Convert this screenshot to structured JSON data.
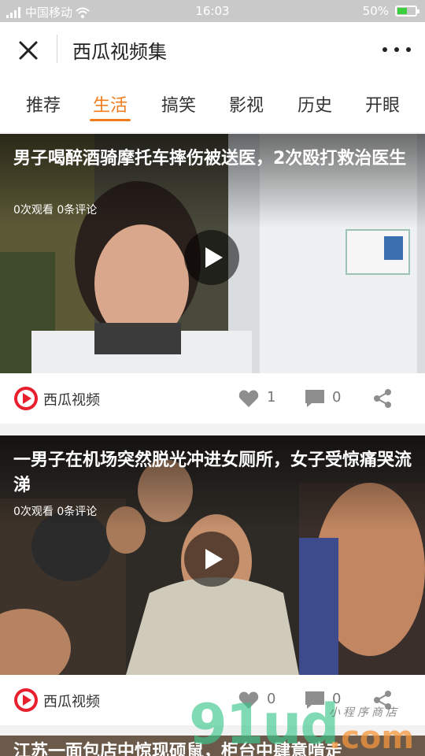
{
  "status_bar": {
    "carrier": "中国移动",
    "time": "16:03",
    "battery": "50%",
    "battery_level": 0.5
  },
  "title_bar": {
    "title": "西瓜视频集"
  },
  "tabs": [
    {
      "label": "推荐",
      "active": false
    },
    {
      "label": "生活",
      "active": true
    },
    {
      "label": "搞笑",
      "active": false
    },
    {
      "label": "影视",
      "active": false
    },
    {
      "label": "历史",
      "active": false
    },
    {
      "label": "开眼",
      "active": false
    }
  ],
  "videos": [
    {
      "title": "男子喝醉酒骑摩托车摔伤被送医，2次殴打救治医生",
      "meta": "0次观看 0条评论",
      "source": "西瓜视频",
      "likes": "1",
      "comments": "0"
    },
    {
      "title": "一男子在机场突然脱光冲进女厕所，女子受惊痛哭流涕",
      "meta": "0次观看 0条评论",
      "source": "西瓜视频",
      "likes": "0",
      "comments": "0"
    },
    {
      "title": "江苏一面包店中惊现硕鼠，柜台中肆意啃走"
    }
  ],
  "watermark": {
    "main": "91ud",
    "suffix": ".com",
    "sub": "小程序商店"
  },
  "colors": {
    "accent": "#f07c1b",
    "logo_red": "#e8202e"
  }
}
